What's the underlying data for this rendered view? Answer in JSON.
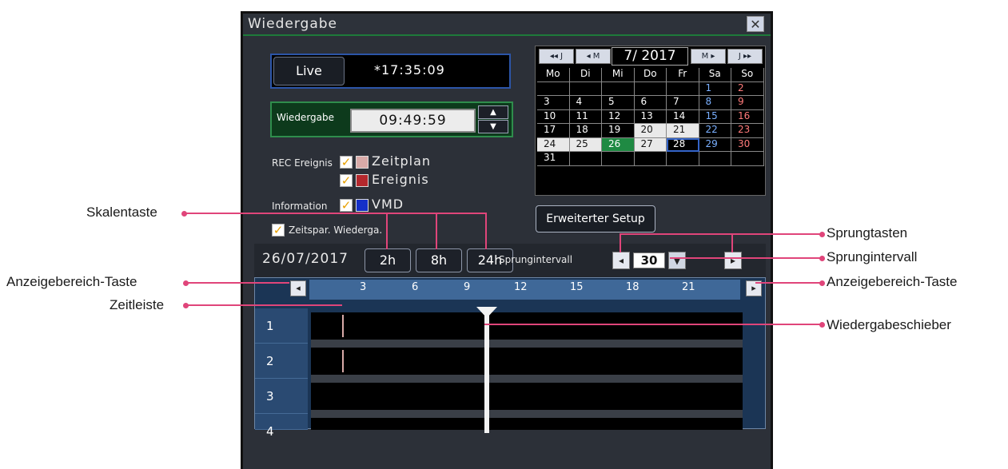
{
  "window": {
    "title": "Wiedergabe",
    "close_label": "✕"
  },
  "live": {
    "button": "Live",
    "time": "*17:35:09"
  },
  "playback": {
    "label": "Wiedergabe",
    "time": "09:49:59",
    "up": "▲",
    "down": "▼"
  },
  "rec": {
    "label": "REC Ereignis",
    "schedule": "Zeitplan",
    "event": "Ereignis"
  },
  "info": {
    "label": "Information",
    "vmd": "VMD"
  },
  "timesave": {
    "label": "Zeitspar. Wiederga."
  },
  "legend_colors": {
    "schedule": "#d8aaa8",
    "event": "#b4282d",
    "vmd": "#1530c8"
  },
  "calendar": {
    "nav": {
      "prev_year": "◂◂ J",
      "prev_month": "◂ M",
      "next_month": "M ▸",
      "next_year": "J ▸▸"
    },
    "month": "7/ 2017",
    "weekdays": [
      "Mo",
      "Di",
      "Mi",
      "Do",
      "Fr",
      "Sa",
      "So"
    ],
    "weeks": [
      [
        "",
        "",
        "",
        "",
        "",
        "1",
        "2"
      ],
      [
        "3",
        "4",
        "5",
        "6",
        "7",
        "8",
        "9"
      ],
      [
        "10",
        "11",
        "12",
        "13",
        "14",
        "15",
        "16"
      ],
      [
        "17",
        "18",
        "19",
        "20",
        "21",
        "22",
        "23"
      ],
      [
        "24",
        "25",
        "26",
        "27",
        "28",
        "29",
        "30"
      ],
      [
        "31",
        "",
        "",
        "",
        "",
        "",
        ""
      ]
    ],
    "recorded_days": [
      "20",
      "21",
      "24",
      "25",
      "27"
    ],
    "selected_day": "26",
    "today": "28"
  },
  "advanced_setup": "Erweiterter Setup",
  "date": "26/07/2017",
  "scale_buttons": [
    "2h",
    "8h",
    "24h"
  ],
  "jump": {
    "label": "Sprungintervall",
    "value": "30",
    "back": "◂",
    "forward": "▸",
    "dropdown": "▼"
  },
  "axis_ticks": [
    "3",
    "6",
    "9",
    "12",
    "15",
    "18",
    "21"
  ],
  "cameras": [
    "1",
    "2",
    "3",
    "4"
  ],
  "range_buttons": {
    "left": "◂",
    "right": "▸"
  },
  "annotations": {
    "skalentaste": "Skalentaste",
    "anzeigebereich_left": "Anzeigebereich-Taste",
    "zeitleiste": "Zeitleiste",
    "sprungtasten": "Sprungtasten",
    "sprungintervall": "Sprungintervall",
    "anzeigebereich_right": "Anzeigebereich-Taste",
    "wiedergabeschieber": "Wiedergabeschieber"
  }
}
